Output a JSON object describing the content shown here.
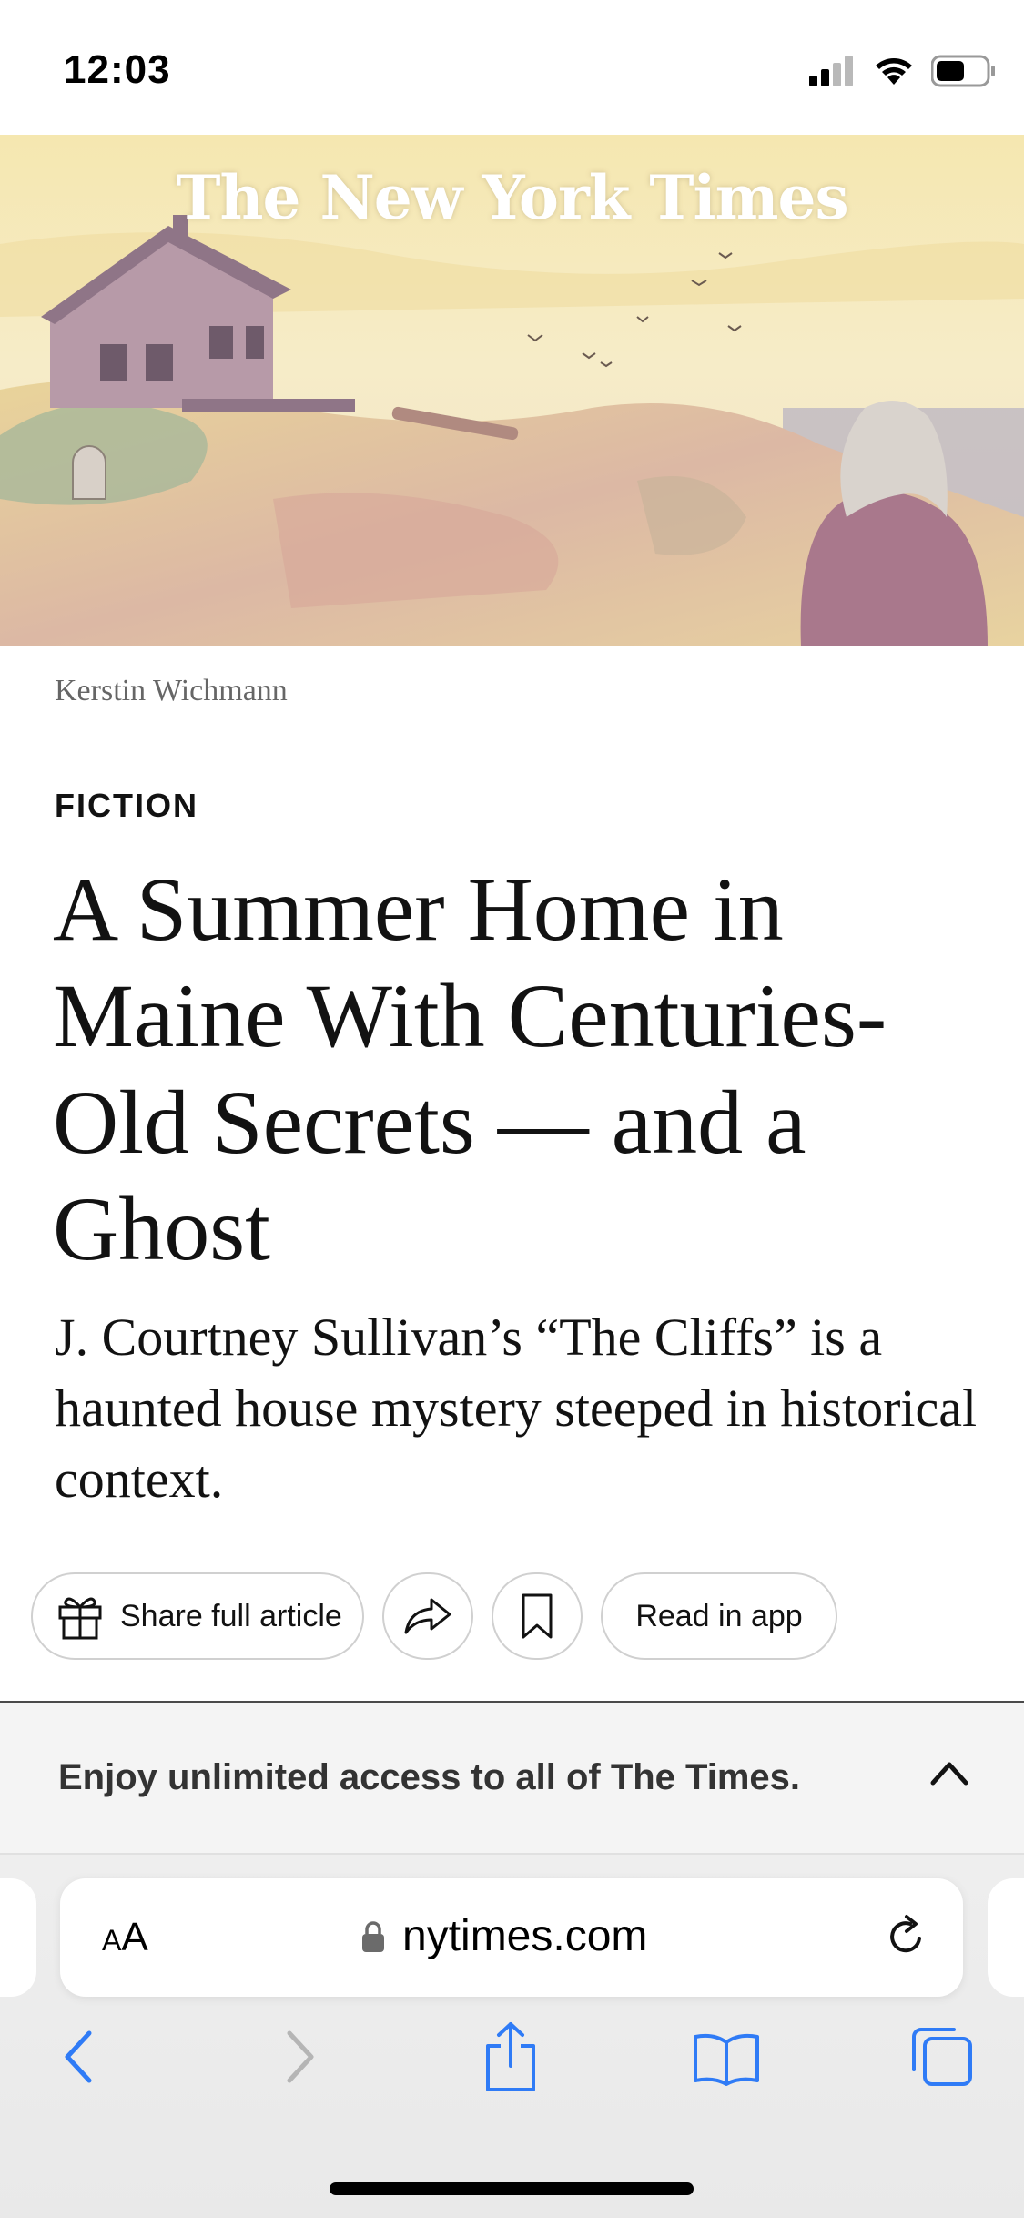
{
  "status_bar": {
    "time": "12:03"
  },
  "hero": {
    "masthead": "The New York Times"
  },
  "article": {
    "photo_credit": "Kerstin Wichmann",
    "kicker": "FICTION",
    "headline": "A Summer Home in Maine With Centuries-Old Secrets — and a Ghost",
    "summary": "J. Courtney Sullivan’s “The Cliffs” is a haunted house mystery steeped in historical context."
  },
  "actions": {
    "share_full": "Share full article",
    "read_in_app": "Read in app"
  },
  "banner": {
    "text": "Enjoy unlimited access to all of The Times."
  },
  "browser": {
    "aa_small": "A",
    "aa_large": "A",
    "url": "nytimes.com"
  },
  "colors": {
    "accent": "#2f7bf6",
    "disabled": "#b5b5b5"
  },
  "icons": [
    "signal-icon",
    "wifi-icon",
    "battery-icon",
    "gift-icon",
    "share-icon",
    "bookmark-icon",
    "chevron-up-icon",
    "lock-icon",
    "reload-icon",
    "back-icon",
    "forward-icon",
    "safari-share-icon",
    "book-icon",
    "tabs-icon"
  ]
}
